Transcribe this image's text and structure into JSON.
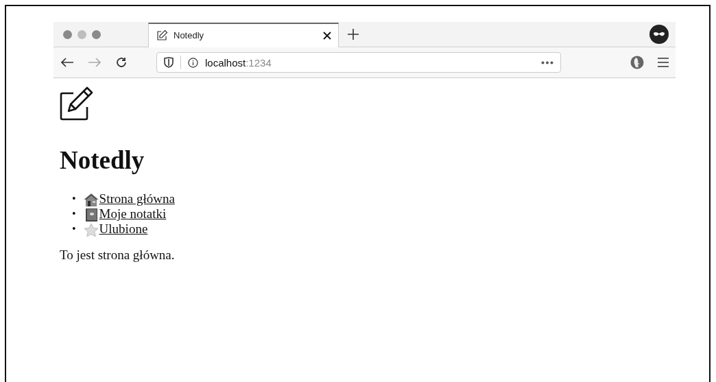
{
  "window": {
    "tab": {
      "title": "Notedly",
      "selected": true
    }
  },
  "address_bar": {
    "host": "localhost",
    "port": ":1234"
  },
  "page": {
    "heading": "Notedly",
    "nav": [
      {
        "marker": "•",
        "label": "Strona główna",
        "kind": "home"
      },
      {
        "marker": "•",
        "label": "Moje notatki",
        "kind": "notes"
      },
      {
        "marker": "•",
        "label": "Ulubione",
        "kind": "star"
      }
    ],
    "text": "To jest strona główna."
  }
}
